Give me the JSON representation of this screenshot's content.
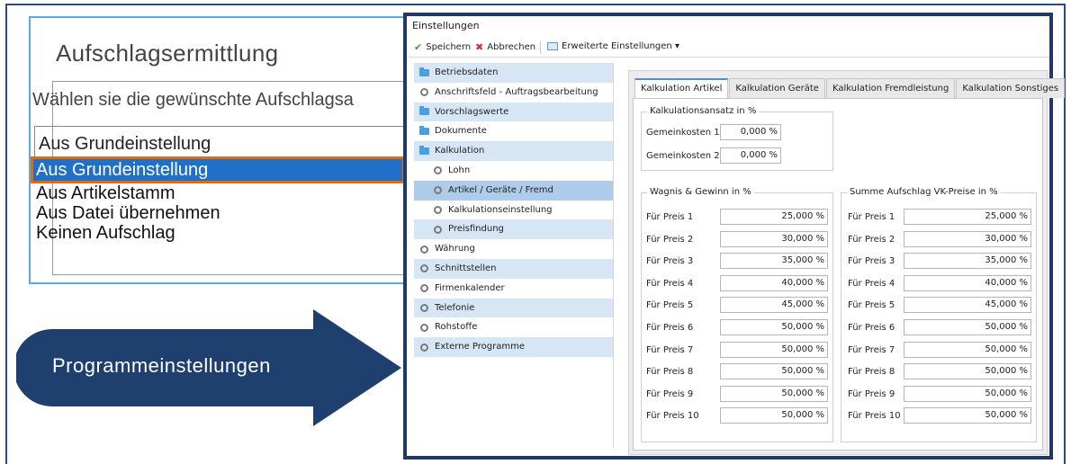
{
  "left_dialog": {
    "title": "Aufschlagsermittlung",
    "prompt": "Wählen sie die gewünschte Aufschlagsa",
    "select_value": "Aus Grundeinstellung",
    "options": [
      "Aus Grundeinstellung",
      "Aus Artikelstamm",
      "Aus Datei übernehmen",
      "Keinen Aufschlag"
    ]
  },
  "arrow": {
    "label": "Programmeinstellungen",
    "color": "#1f3f6e"
  },
  "window": {
    "title": "Einstellungen",
    "toolbar": {
      "save": "Speichern",
      "cancel": "Abbrechen",
      "advanced": "Erweiterte Einstellungen ▾"
    },
    "tree": [
      {
        "label": "Betriebsdaten",
        "icon": "folder-icon",
        "level": 0
      },
      {
        "label": "Anschriftsfeld - Auftragsbearbeitung",
        "icon": "gear-icon",
        "level": 0
      },
      {
        "label": "Vorschlagswerte",
        "icon": "folder-icon",
        "level": 0
      },
      {
        "label": "Dokumente",
        "icon": "folder-icon",
        "level": 0
      },
      {
        "label": "Kalkulation",
        "icon": "folder-open-icon",
        "level": 0
      },
      {
        "label": "Lohn",
        "icon": "gear-icon",
        "level": 1
      },
      {
        "label": "Artikel / Geräte / Fremd",
        "icon": "gear-icon",
        "level": 1
      },
      {
        "label": "Kalkulationseinstellung",
        "icon": "gear-icon",
        "level": 1
      },
      {
        "label": "Preisfindung",
        "icon": "gear-icon",
        "level": 1
      },
      {
        "label": "Währung",
        "icon": "gear-icon",
        "level": 0
      },
      {
        "label": "Schnittstellen",
        "icon": "gear-icon",
        "level": 0
      },
      {
        "label": "Firmenkalender",
        "icon": "gear-icon",
        "level": 0
      },
      {
        "label": "Telefonie",
        "icon": "gear-icon",
        "level": 0
      },
      {
        "label": "Rohstoffe",
        "icon": "gear-icon",
        "level": 0
      },
      {
        "label": "Externe Programme",
        "icon": "gear-icon",
        "level": 0
      }
    ],
    "tabs": [
      "Kalkulation Artikel",
      "Kalkulation Geräte",
      "Kalkulation Fremdleistung",
      "Kalkulation Sonstiges"
    ],
    "kalkulationsansatz": {
      "label": "Kalkulationsansatz in %",
      "rows": [
        {
          "label": "Gemeinkosten 1",
          "value": "0,000 %"
        },
        {
          "label": "Gemeinkosten 2",
          "value": "0,000 %"
        }
      ]
    },
    "wagnis": {
      "label": "Wagnis & Gewinn in %",
      "rows": [
        {
          "label": "Für Preis 1",
          "value": "25,000 %"
        },
        {
          "label": "Für Preis 2",
          "value": "30,000 %"
        },
        {
          "label": "Für Preis 3",
          "value": "35,000 %"
        },
        {
          "label": "Für Preis 4",
          "value": "40,000 %"
        },
        {
          "label": "Für Preis 5",
          "value": "45,000 %"
        },
        {
          "label": "Für Preis 6",
          "value": "50,000 %"
        },
        {
          "label": "Für Preis 7",
          "value": "50,000 %"
        },
        {
          "label": "Für Preis 8",
          "value": "50,000 %"
        },
        {
          "label": "Für Preis 9",
          "value": "50,000 %"
        },
        {
          "label": "Für Preis 10",
          "value": "50,000 %"
        }
      ]
    },
    "summe": {
      "label": "Summe Aufschlag VK-Preise in %",
      "rows": [
        {
          "label": "Für Preis 1",
          "value": "25,000 %"
        },
        {
          "label": "Für Preis 2",
          "value": "30,000 %"
        },
        {
          "label": "Für Preis 3",
          "value": "35,000 %"
        },
        {
          "label": "Für Preis 4",
          "value": "40,000 %"
        },
        {
          "label": "Für Preis 5",
          "value": "45,000 %"
        },
        {
          "label": "Für Preis 6",
          "value": "50,000 %"
        },
        {
          "label": "Für Preis 7",
          "value": "50,000 %"
        },
        {
          "label": "Für Preis 8",
          "value": "50,000 %"
        },
        {
          "label": "Für Preis 9",
          "value": "50,000 %"
        },
        {
          "label": "Für Preis 10",
          "value": "50,000 %"
        }
      ]
    }
  }
}
